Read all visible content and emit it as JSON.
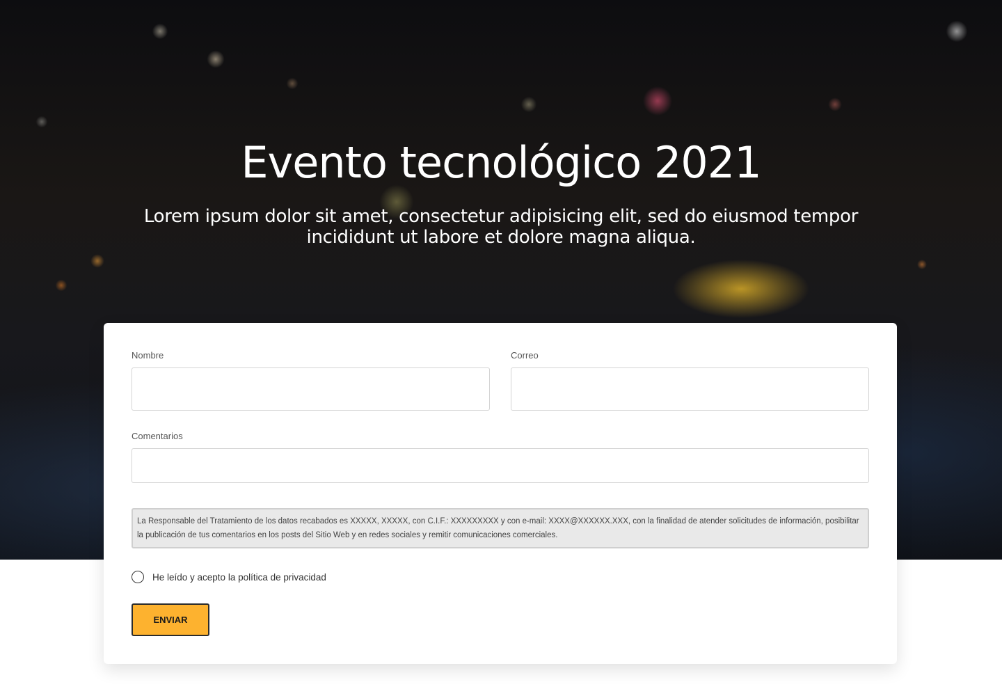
{
  "hero": {
    "title": "Evento tecnológico 2021",
    "subtitle": "Lorem ipsum dolor sit amet, consectetur adipisicing elit, sed do eiusmod tempor incididunt ut labore et dolore magna aliqua.",
    "background_image": "night-city-taxi-bokeh"
  },
  "form": {
    "name_label": "Nombre",
    "name_value": "",
    "email_label": "Correo",
    "email_value": "",
    "comments_label": "Comentarios",
    "comments_value": "",
    "legal_text": "La Responsable del Tratamiento de los datos recabados es XXXXX, XXXXX, con C.I.F.: XXXXXXXXX y con e-mail: XXXX@XXXXXX.XXX, con la finalidad de atender solicitudes de información, posibilitar la publicación de tus comentarios en los posts del Sitio Web y en redes sociales y remitir comunicaciones comerciales.",
    "consent_label": "He leído y acepto la política de privacidad",
    "consent_checked": false,
    "submit_label": "ENVIAR"
  },
  "colors": {
    "accent": "#fdb22f",
    "card_background": "#ffffff",
    "legal_background": "#e9e9e9"
  }
}
